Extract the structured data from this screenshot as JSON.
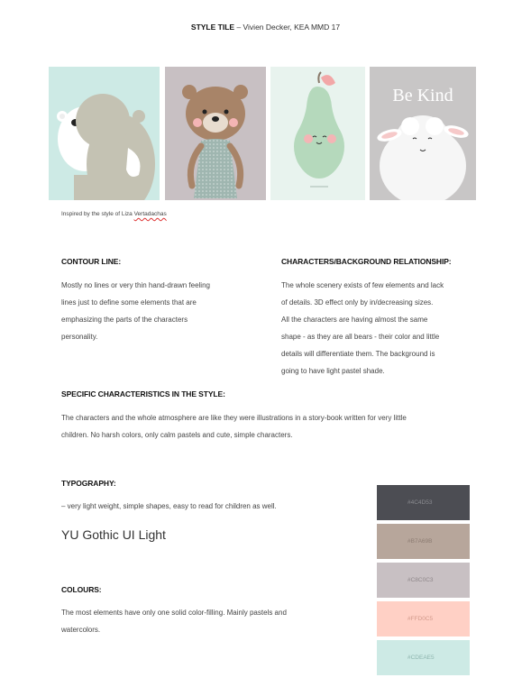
{
  "header": {
    "title_bold": "STYLE TILE",
    "title_rest": " – Vivien Decker, KEA MMD 17"
  },
  "artworks": [
    {
      "subject": "polar bear and grey bear hugging",
      "bg": "#cdeae5"
    },
    {
      "subject": "brown bear in patterned dress",
      "bg": "#c8c0c3"
    },
    {
      "subject": "smiling green pear",
      "bg": "#e8f3ee"
    },
    {
      "subject": "white sheep",
      "bg": "#c8c6c6",
      "text": "Be Kind"
    }
  ],
  "caption": {
    "prefix": "Inspired by the style of Liza ",
    "name": "Vertadachas"
  },
  "sections": {
    "contour": {
      "heading": "CONTOUR LINE:",
      "lines": [
        "Mostly no lines or very thin hand-drawn feeling",
        "lines just to define some elements that are",
        "emphasizing the parts of the characters",
        "personality."
      ]
    },
    "characters": {
      "heading": "CHARACTERS/BACKGROUND RELATIONSHIP:",
      "lines": [
        "The whole scenery exists of few elements and lack",
        "of details. 3D effect only by in/decreasing sizes.",
        "All the characters are having almost the same",
        "shape - as they are all bears - their color and little",
        "details will differentiate them. The background is",
        "going to have light pastel shade."
      ]
    },
    "specific": {
      "heading": "SPECIFIC CHARACTERISTICS IN THE STYLE:",
      "lines": [
        "The characters and the whole atmosphere are like they were illustrations in a story-book written for very little",
        "children. No harsh colors, only calm pastels and cute, simple characters."
      ]
    },
    "typography": {
      "heading": "TYPOGRAPHY:",
      "text": "– very light weight, simple shapes, easy to read for children as well.",
      "sample": "YU Gothic UI Light"
    },
    "colours": {
      "heading": "COLOURS:",
      "lines": [
        "The most elements have only one solid color-filling. Mainly pastels and",
        "watercolors."
      ]
    }
  },
  "swatches": [
    {
      "label": "#4C4D53",
      "color": "#4c4d53",
      "text_color": "#8a8b90"
    },
    {
      "label": "#B7A69B",
      "color": "#b7a69b",
      "text_color": "#8c7c72"
    },
    {
      "label": "#C8C0C3",
      "color": "#c8c0c3",
      "text_color": "#8f878a"
    },
    {
      "label": "#FFD0C5",
      "color": "#ffd0c5",
      "text_color": "#d39a8c"
    },
    {
      "label": "#CDEAE5",
      "color": "#cdeae5",
      "text_color": "#8db5ae"
    }
  ]
}
